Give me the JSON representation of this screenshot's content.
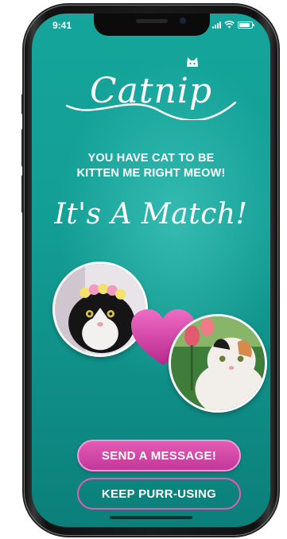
{
  "status_bar": {
    "time": "9:41"
  },
  "brand": {
    "name": "Catnip"
  },
  "match_screen": {
    "tagline_line1": "YOU HAVE CAT TO BE",
    "tagline_line2": "KITTEN ME RIGHT MEOW!",
    "title": "It's A Match!",
    "photos": [
      {
        "icon": "cat-photo-flower-crown"
      },
      {
        "icon": "cat-photo-calico-tulips"
      }
    ],
    "heart_icon": "heart-icon",
    "send_message_label": "SEND A MESSAGE!",
    "keep_browsing_label": "KEEP PURR-USING"
  },
  "colors": {
    "background_teal": "#139e95",
    "accent_pink": "#d94aad",
    "text": "#ffffff"
  }
}
